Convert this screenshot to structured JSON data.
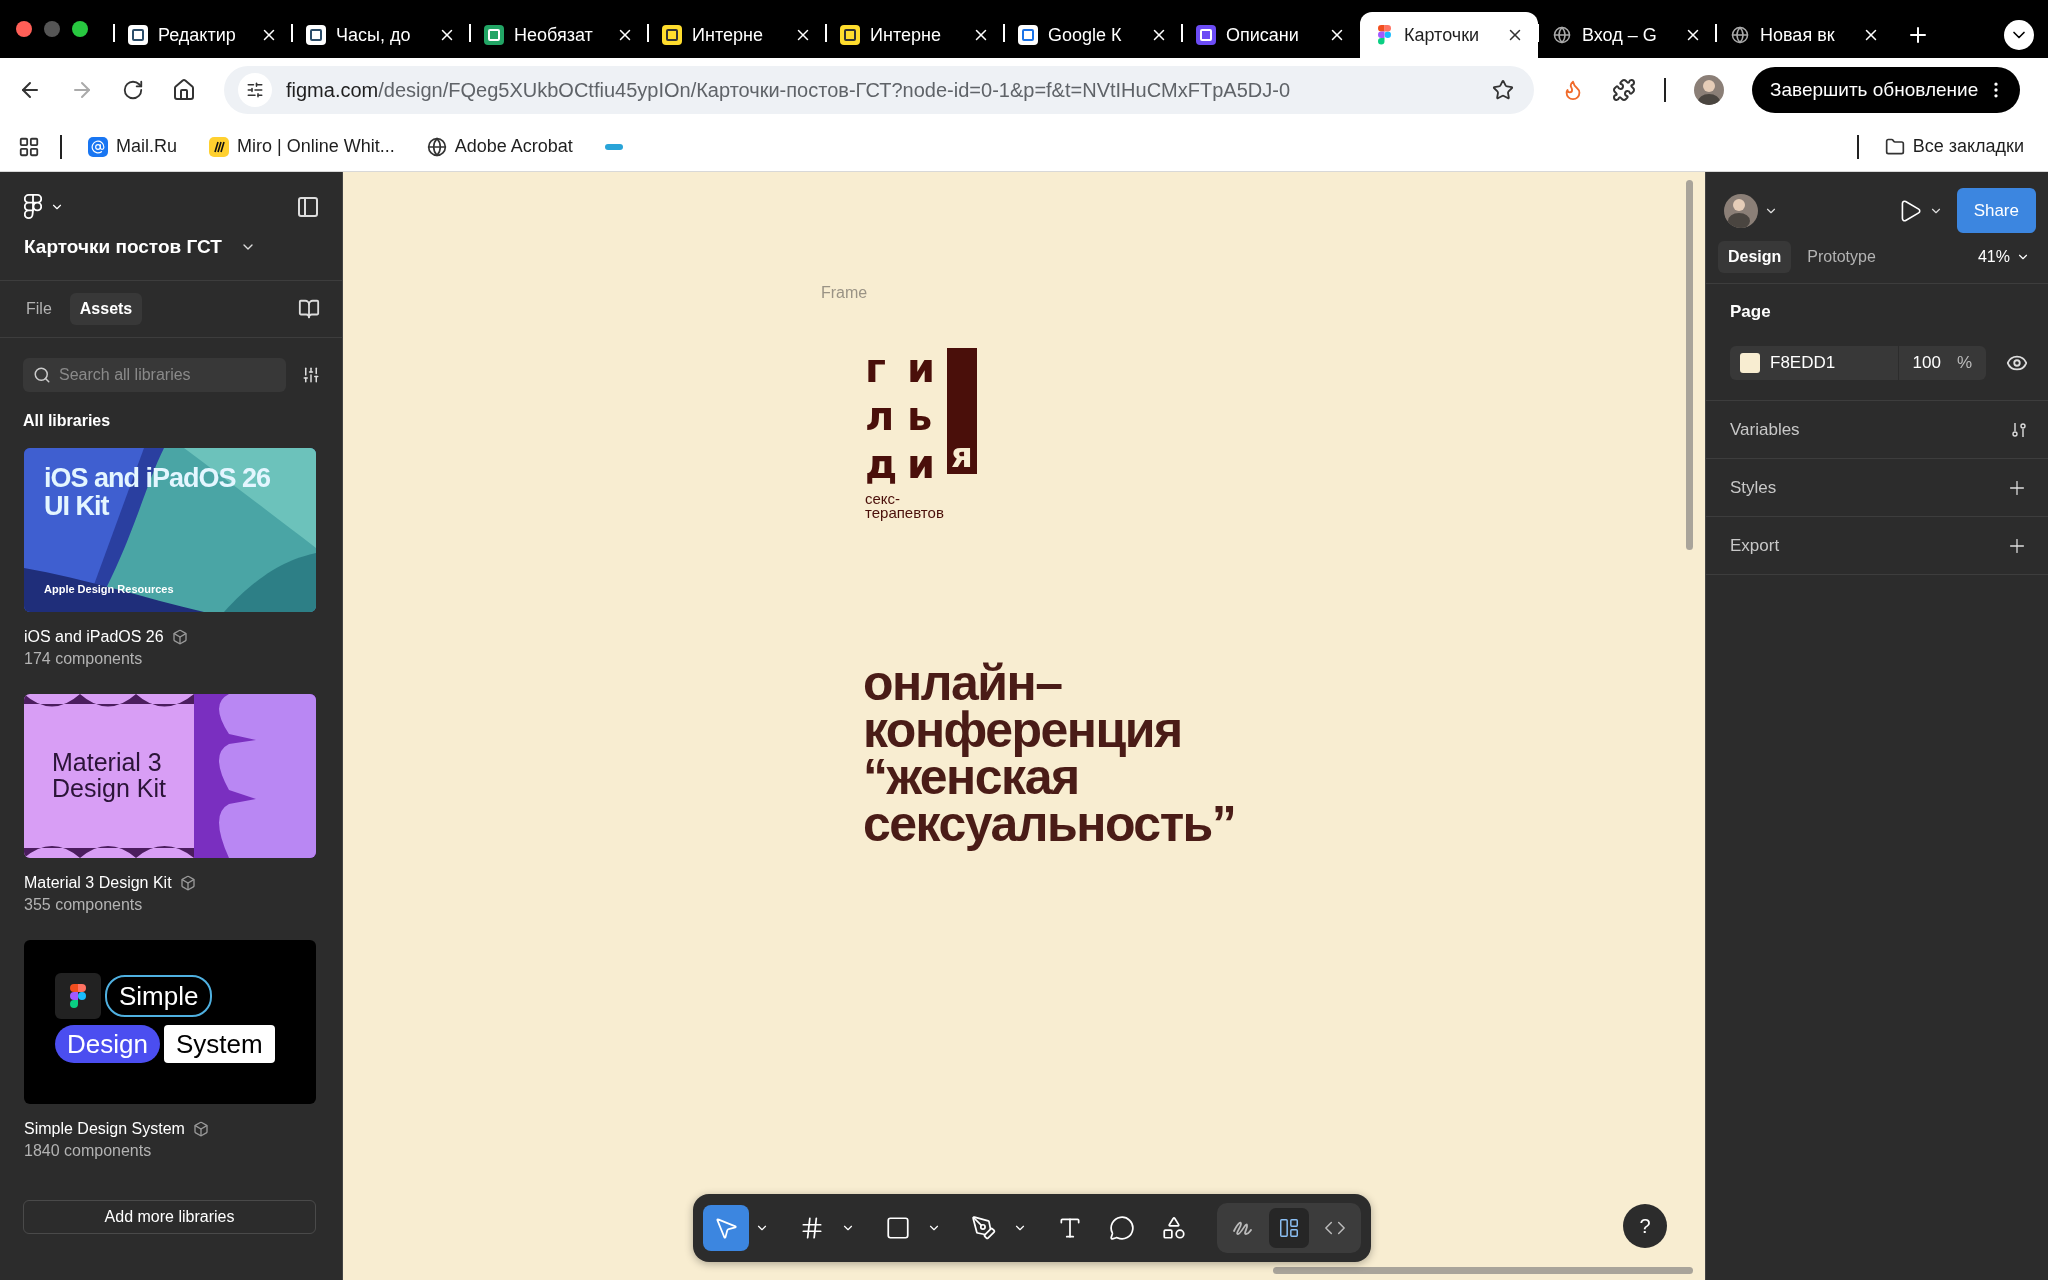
{
  "browser": {
    "tabs": [
      {
        "title": "Редактир",
        "kind": "doc",
        "selected": false
      },
      {
        "title": "Часы, до",
        "kind": "doc",
        "selected": false
      },
      {
        "title": "Необязат",
        "kind": "sheet",
        "selected": false
      },
      {
        "title": "Интерне",
        "kind": "bank",
        "selected": false
      },
      {
        "title": "Интерне",
        "kind": "bank",
        "selected": false
      },
      {
        "title": "Google К",
        "kind": "calendar",
        "selected": false
      },
      {
        "title": "Описани",
        "kind": "letter",
        "selected": false
      },
      {
        "title": "Карточки",
        "kind": "figma",
        "selected": true
      },
      {
        "title": "Вход – G",
        "kind": "globe",
        "selected": false
      },
      {
        "title": "Новая вк",
        "kind": "chrome",
        "selected": false
      }
    ],
    "address": {
      "host": "figma.com",
      "path": "/design/FQeg5XUkbOCtfiu45ypIOn/Карточки-постов-ГСТ?node-id=0-1&p=f&t=NVtIHuCMxFTpA5DJ-0"
    },
    "update_button": "Завершить обновление",
    "bookmarks": [
      {
        "label": "Mail.Ru",
        "kind": "at"
      },
      {
        "label": "Miro | Online Whit...",
        "kind": "miro"
      },
      {
        "label": "Adobe Acrobat",
        "kind": "globe"
      },
      {
        "kind": "mark"
      }
    ],
    "all_bookmarks": "Все закладки"
  },
  "left_panel": {
    "file_name": "Карточки постов ГСТ",
    "tabs": [
      {
        "label": "File",
        "selected": false
      },
      {
        "label": "Assets",
        "selected": true
      }
    ],
    "search": {
      "placeholder": "Search all libraries"
    },
    "section_title": "All libraries",
    "libraries": [
      {
        "name": "iOS and iPadOS 26",
        "count": "174 components",
        "cover": {
          "kind": "ios",
          "lines": [
            "iOS and iPadOS 26",
            "UI Kit"
          ],
          "footer": "Apple Design Resources"
        }
      },
      {
        "name": "Material 3 Design Kit",
        "count": "355 components",
        "cover": {
          "kind": "material",
          "lines": [
            "Material 3",
            "Design Kit"
          ]
        }
      },
      {
        "name": "Simple Design System",
        "count": "1840 components",
        "cover": {
          "kind": "sds",
          "lines": [
            "Simple",
            "Design",
            "System"
          ]
        }
      }
    ],
    "add_button": "Add more libraries"
  },
  "canvas": {
    "frame_label": "Frame",
    "logo": {
      "rows": [
        [
          "г",
          "и"
        ],
        [
          "л",
          "ь"
        ],
        [
          "д",
          "и"
        ]
      ],
      "bar_letter": "я",
      "subtitle_lines": [
        "секс-",
        "терапевтов"
      ]
    },
    "headline_lines": [
      "онлайн–",
      "конференция",
      "“женская",
      "сексуальность”"
    ]
  },
  "toolbar": {
    "tools": [
      {
        "kind": "move",
        "selected": true
      },
      {
        "kind": "frame",
        "selected": false
      },
      {
        "kind": "rectangle",
        "selected": false
      },
      {
        "kind": "pen",
        "selected": false
      },
      {
        "kind": "text",
        "selected": false
      },
      {
        "kind": "comment",
        "selected": false
      },
      {
        "kind": "actions",
        "selected": false
      }
    ],
    "modes": [
      {
        "kind": "draw",
        "selected": false
      },
      {
        "kind": "design",
        "selected": true
      },
      {
        "kind": "dev",
        "selected": false
      }
    ]
  },
  "right_panel": {
    "share": "Share",
    "tabs": [
      {
        "label": "Design",
        "selected": true
      },
      {
        "label": "Prototype",
        "selected": false
      }
    ],
    "zoom": "41%",
    "page_title": "Page",
    "page_fill": {
      "hex": "F8EDD1",
      "opacity": "100",
      "unit": "%"
    },
    "sections": [
      {
        "label": "Variables",
        "kind": "variables"
      },
      {
        "label": "Styles",
        "kind": "plus"
      },
      {
        "label": "Export",
        "kind": "plus"
      }
    ]
  },
  "help": "?"
}
